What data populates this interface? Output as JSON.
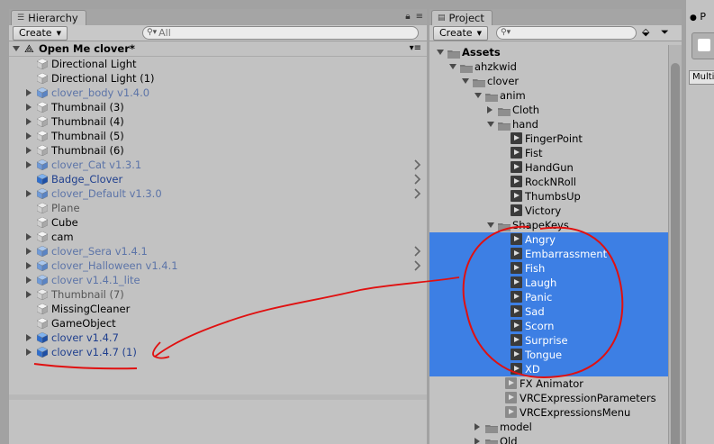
{
  "hierarchy": {
    "tab_label": "Hierarchy",
    "create_label": "Create",
    "search_placeholder": "All",
    "scene_name": "Open Me clover*",
    "items": [
      {
        "label": "Directional Light",
        "style": "normal",
        "expand": false,
        "chevron": false,
        "icon": "gameobject"
      },
      {
        "label": "Directional Light (1)",
        "style": "normal",
        "expand": false,
        "chevron": false,
        "icon": "gameobject"
      },
      {
        "label": "clover_body v1.4.0",
        "style": "prefabfade",
        "expand": true,
        "chevron": false,
        "icon": "prefab-fade"
      },
      {
        "label": "Thumbnail (3)",
        "style": "normal",
        "expand": true,
        "chevron": false,
        "icon": "gameobject"
      },
      {
        "label": "Thumbnail (4)",
        "style": "normal",
        "expand": true,
        "chevron": false,
        "icon": "gameobject"
      },
      {
        "label": "Thumbnail (5)",
        "style": "normal",
        "expand": true,
        "chevron": false,
        "icon": "gameobject"
      },
      {
        "label": "Thumbnail (6)",
        "style": "normal",
        "expand": true,
        "chevron": false,
        "icon": "gameobject"
      },
      {
        "label": "clover_Cat v1.3.1",
        "style": "prefabfade",
        "expand": true,
        "chevron": true,
        "icon": "prefab-fade"
      },
      {
        "label": "Badge_Clover",
        "style": "prefab",
        "expand": false,
        "chevron": true,
        "icon": "prefab"
      },
      {
        "label": "clover_Default v1.3.0",
        "style": "prefabfade",
        "expand": true,
        "chevron": true,
        "icon": "prefab-fade"
      },
      {
        "label": "Plane",
        "style": "inactive",
        "expand": false,
        "chevron": false,
        "icon": "gameobject-fade"
      },
      {
        "label": "Cube",
        "style": "normal",
        "expand": false,
        "chevron": false,
        "icon": "gameobject"
      },
      {
        "label": "cam",
        "style": "normal",
        "expand": true,
        "chevron": false,
        "icon": "gameobject"
      },
      {
        "label": "clover_Sera v1.4.1",
        "style": "prefabfade",
        "expand": true,
        "chevron": true,
        "icon": "prefab-fade"
      },
      {
        "label": "clover_Halloween v1.4.1",
        "style": "prefabfade",
        "expand": true,
        "chevron": true,
        "icon": "prefab-fade"
      },
      {
        "label": "clover v1.4.1_lite",
        "style": "prefabfade",
        "expand": true,
        "chevron": false,
        "icon": "prefab-fade"
      },
      {
        "label": "Thumbnail (7)",
        "style": "inactive",
        "expand": true,
        "chevron": false,
        "icon": "gameobject-fade"
      },
      {
        "label": "MissingCleaner",
        "style": "normal",
        "expand": false,
        "chevron": false,
        "icon": "gameobject"
      },
      {
        "label": "GameObject",
        "style": "normal",
        "expand": false,
        "chevron": false,
        "icon": "gameobject"
      },
      {
        "label": "clover v1.4.7",
        "style": "prefab",
        "expand": true,
        "chevron": false,
        "icon": "prefab"
      },
      {
        "label": "clover v1.4.7 (1)",
        "style": "prefab",
        "expand": true,
        "chevron": false,
        "icon": "prefab"
      }
    ]
  },
  "project": {
    "tab_label": "Project",
    "create_label": "Create",
    "tree": [
      {
        "label": "Assets",
        "depth": 0,
        "type": "folder",
        "expanded": true,
        "bold": true,
        "selected": false
      },
      {
        "label": "ahzkwid",
        "depth": 1,
        "type": "folder",
        "expanded": true,
        "selected": false
      },
      {
        "label": "clover",
        "depth": 2,
        "type": "folder",
        "expanded": true,
        "selected": false
      },
      {
        "label": "anim",
        "depth": 3,
        "type": "folder",
        "expanded": true,
        "selected": false
      },
      {
        "label": "Cloth",
        "depth": 4,
        "type": "folder",
        "expanded": false,
        "selected": false
      },
      {
        "label": "hand",
        "depth": 4,
        "type": "folder",
        "expanded": true,
        "selected": false
      },
      {
        "label": "FingerPoint",
        "depth": 5,
        "type": "anim",
        "selected": false
      },
      {
        "label": "Fist",
        "depth": 5,
        "type": "anim",
        "selected": false
      },
      {
        "label": "HandGun",
        "depth": 5,
        "type": "anim",
        "selected": false
      },
      {
        "label": "RockNRoll",
        "depth": 5,
        "type": "anim",
        "selected": false
      },
      {
        "label": "ThumbsUp",
        "depth": 5,
        "type": "anim",
        "selected": false
      },
      {
        "label": "Victory",
        "depth": 5,
        "type": "anim",
        "selected": false
      },
      {
        "label": "ShapeKeys",
        "depth": 4,
        "type": "folder",
        "expanded": true,
        "selected": false
      },
      {
        "label": "Angry",
        "depth": 5,
        "type": "anim",
        "selected": true
      },
      {
        "label": "Embarrassment",
        "depth": 5,
        "type": "anim",
        "selected": true
      },
      {
        "label": "Fish",
        "depth": 5,
        "type": "anim",
        "selected": true
      },
      {
        "label": "Laugh",
        "depth": 5,
        "type": "anim",
        "selected": true
      },
      {
        "label": "Panic",
        "depth": 5,
        "type": "anim",
        "selected": true
      },
      {
        "label": "Sad",
        "depth": 5,
        "type": "anim",
        "selected": true
      },
      {
        "label": "Scorn",
        "depth": 5,
        "type": "anim",
        "selected": true
      },
      {
        "label": "Surprise",
        "depth": 5,
        "type": "anim",
        "selected": true
      },
      {
        "label": "Tongue",
        "depth": 5,
        "type": "anim",
        "selected": true
      },
      {
        "label": "XD",
        "depth": 5,
        "type": "anim",
        "selected": true
      },
      {
        "label": "FX Animator",
        "depth": 4,
        "type": "asset",
        "selected": false
      },
      {
        "label": "VRCExpressionParameters",
        "depth": 4,
        "type": "asset",
        "selected": false
      },
      {
        "label": "VRCExpressionsMenu",
        "depth": 4,
        "type": "asset",
        "selected": false
      },
      {
        "label": "model",
        "depth": 3,
        "type": "folder",
        "expanded": false,
        "selected": false
      },
      {
        "label": "Old",
        "depth": 3,
        "type": "folder",
        "expanded": false,
        "selected": false
      }
    ]
  },
  "inspector": {
    "tab_label": "P",
    "field_label": "Multi"
  },
  "colors": {
    "selection": "#3d7fe4",
    "annotation": "#e01010",
    "prefab_text": "#1f3f8e"
  }
}
